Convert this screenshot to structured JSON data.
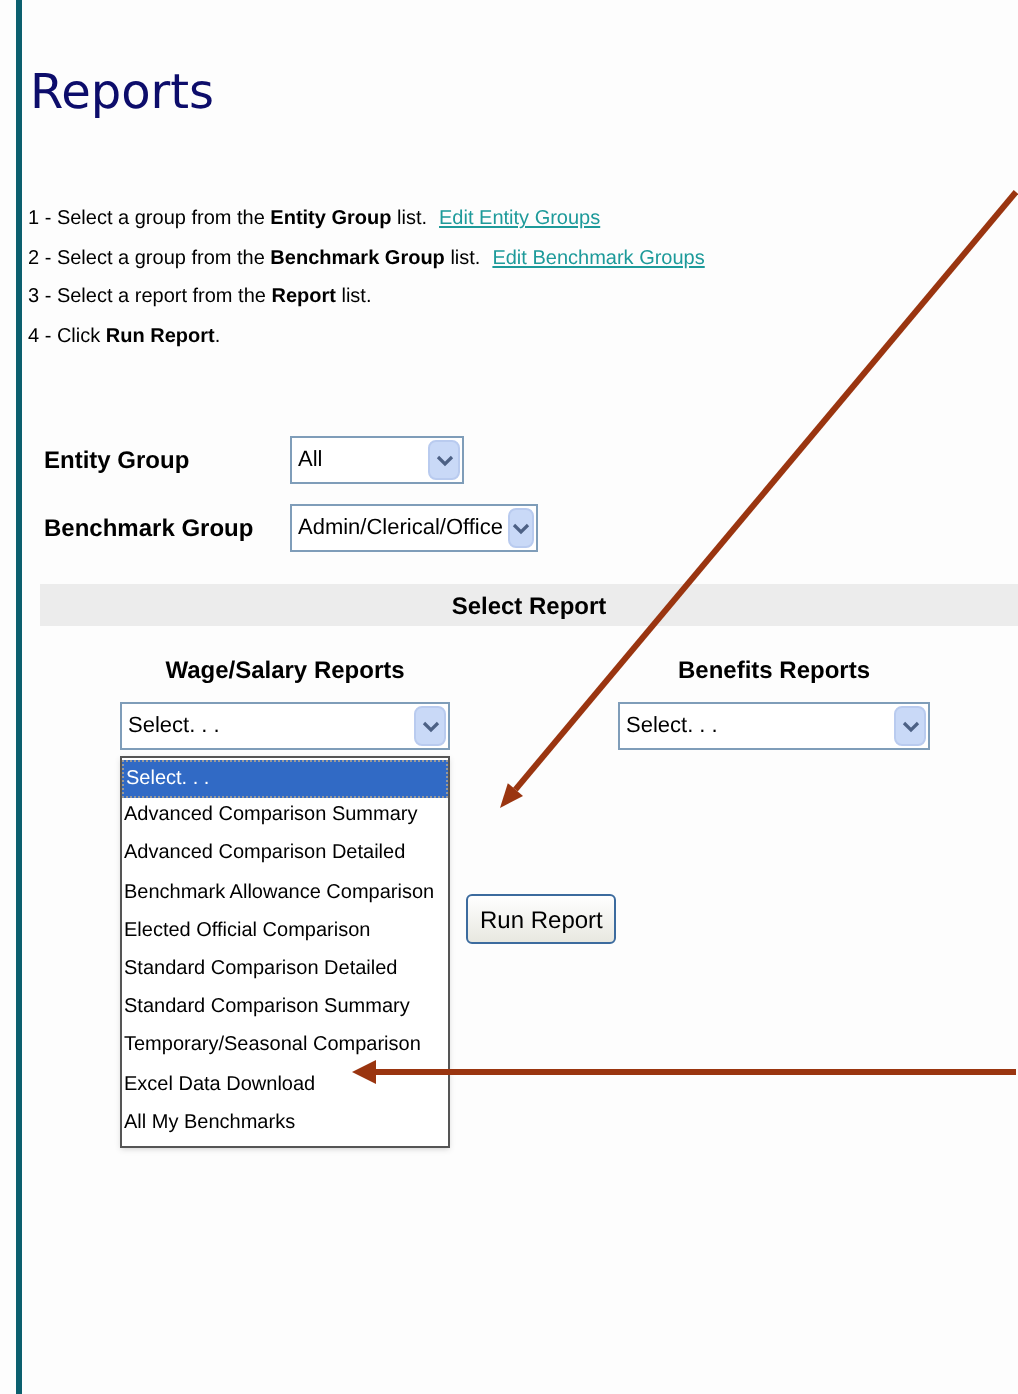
{
  "page": {
    "title": "Reports"
  },
  "instructions": [
    {
      "text": "1 - Select a group from the **Entity Group** list.",
      "link": "Edit Entity Groups"
    },
    {
      "text": "2 - Select a group from the **Benchmark Group** list.",
      "link": "Edit Benchmark Groups"
    },
    {
      "text": "3 - Select a report from the **Report** list."
    },
    {
      "text": "4 - Click **Run Report**."
    }
  ],
  "filters": [
    {
      "label": "Entity Group",
      "value": "All"
    },
    {
      "label": "Benchmark Group",
      "value": "Admin/Clerical/Office"
    }
  ],
  "section": {
    "title": "Select Report"
  },
  "report_columns": [
    {
      "heading": "Wage/Salary Reports",
      "value": "Select. . .",
      "options": [
        {
          "label": "Select. . .",
          "selected": true
        },
        {
          "label": "Advanced Comparison Summary",
          "selected": false
        },
        {
          "label": "Advanced Comparison Detailed",
          "selected": false
        },
        {
          "label": "Benchmark Allowance Comparison",
          "selected": false
        },
        {
          "label": "Elected Official Comparison",
          "selected": false
        },
        {
          "label": "Standard Comparison Detailed",
          "selected": false
        },
        {
          "label": "Standard Comparison Summary",
          "selected": false
        },
        {
          "label": "Temporary/Seasonal Comparison",
          "selected": false
        },
        {
          "label": "Excel Data Download",
          "selected": false
        },
        {
          "label": "All My Benchmarks",
          "selected": false
        }
      ]
    },
    {
      "heading": "Benefits Reports",
      "value": "Select. . ."
    }
  ],
  "run_button": {
    "label": "Run Report"
  }
}
